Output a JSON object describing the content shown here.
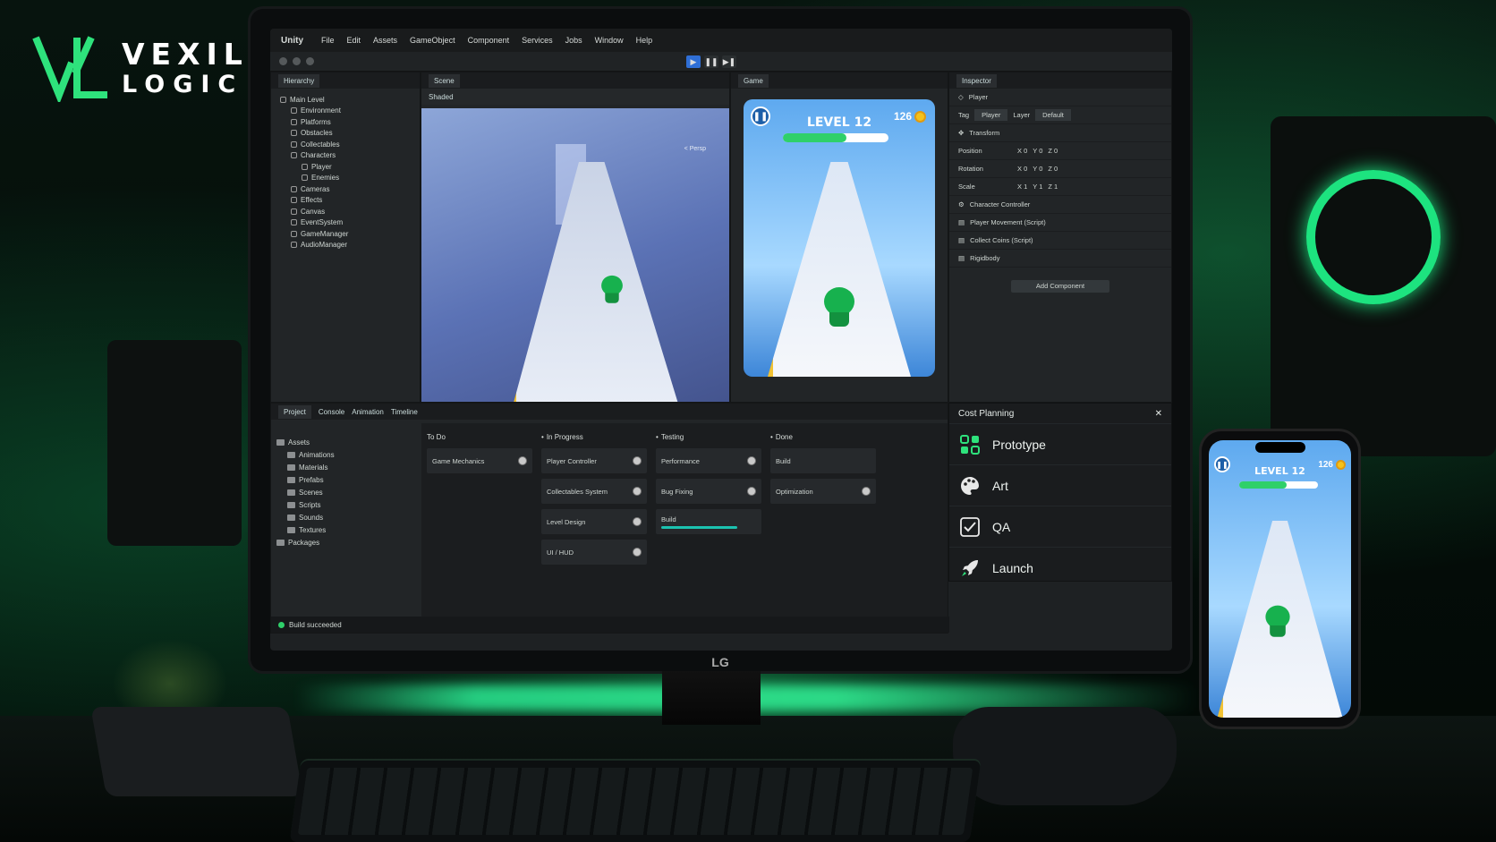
{
  "logo": {
    "line1": "VEXIL",
    "line2": "LOGIC",
    "accent": "#2ee27c"
  },
  "monitor_brand": "LG",
  "menu": {
    "app": "Unity",
    "items": [
      "File",
      "Edit",
      "Assets",
      "GameObject",
      "Component",
      "Services",
      "Jobs",
      "Window",
      "Help"
    ]
  },
  "hierarchy": {
    "tab": "Hierarchy",
    "items": [
      "Main Level",
      "Environment",
      "Platforms",
      "Obstacles",
      "Collectables",
      "Characters",
      "Player",
      "Enemies",
      "Cameras",
      "Effects",
      "Canvas",
      "EventSystem",
      "GameManager",
      "AudioManager"
    ]
  },
  "scene": {
    "tab": "Scene",
    "mode": "Shaded",
    "persp": "< Persp"
  },
  "game": {
    "tab": "Game",
    "level": "LEVEL 12",
    "coins": "126",
    "progress": 0.6
  },
  "inspector": {
    "tab": "Inspector",
    "object": "Player",
    "tag_label": "Tag",
    "tag": "Player",
    "layer_label": "Layer",
    "layer": "Default",
    "transform": "Transform",
    "position": "Position",
    "rotation": "Rotation",
    "scale": "Scale",
    "components": [
      "Character Controller",
      "Player Movement (Script)",
      "Collect Coins (Script)",
      "Rigidbody"
    ],
    "add_component": "Add Component"
  },
  "project": {
    "tabs": [
      "Project",
      "Console",
      "Animation",
      "Timeline"
    ],
    "tree": [
      "Assets",
      "Animations",
      "Materials",
      "Prefabs",
      "Scenes",
      "Scripts",
      "Sounds",
      "Textures",
      "Packages"
    ]
  },
  "board": {
    "columns": [
      {
        "title": "To Do",
        "cards": [
          "Game Mechanics"
        ]
      },
      {
        "title": "In Progress",
        "cards": [
          "Player Controller",
          "Collectables System",
          "Level Design",
          "UI / HUD"
        ]
      },
      {
        "title": "Testing",
        "cards": [
          "Performance",
          "Bug Fixing",
          "Build"
        ]
      },
      {
        "title": "Done",
        "cards": [
          "Build",
          "Optimization"
        ]
      }
    ]
  },
  "cost": {
    "title": "Cost Planning",
    "items": [
      "Prototype",
      "Art",
      "QA",
      "Launch"
    ]
  },
  "status": "Build succeeded",
  "phone": {
    "level": "LEVEL 12",
    "coins": "126",
    "progress": 0.6
  }
}
